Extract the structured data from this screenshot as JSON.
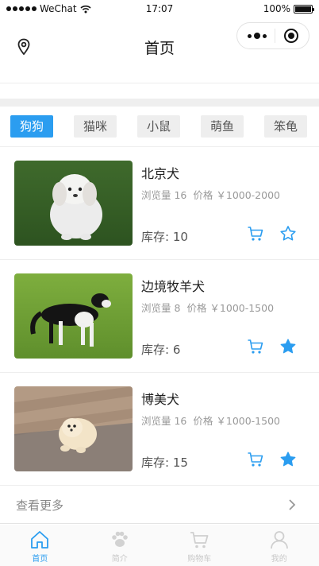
{
  "status_bar": {
    "carrier": "WeChat",
    "time": "17:07",
    "battery": "100%",
    "battery_level": 1.0
  },
  "nav": {
    "title": "首页"
  },
  "tabs": [
    {
      "label": "狗狗",
      "active": true
    },
    {
      "label": "猫咪",
      "active": false
    },
    {
      "label": "小鼠",
      "active": false
    },
    {
      "label": "萌鱼",
      "active": false
    },
    {
      "label": "笨龟",
      "active": false
    }
  ],
  "products": [
    {
      "name": "北京犬",
      "views": "浏览量 16",
      "price": "价格 ￥1000-2000",
      "stock": "库存:  10",
      "favorited": false,
      "image": "white-pekingese-on-grass"
    },
    {
      "name": "边境牧羊犬",
      "views": "浏览量 8",
      "price": "价格 ￥1000-1500",
      "stock": "库存:  6",
      "favorited": true,
      "image": "border-collie-on-grass"
    },
    {
      "name": "博美犬",
      "views": "浏览量 16",
      "price": "价格 ￥1000-1500",
      "stock": "库存:  15",
      "favorited": true,
      "image": "pomeranian-on-pavement"
    }
  ],
  "more": {
    "label": "查看更多"
  },
  "tab_bar": [
    {
      "label": "首页",
      "icon": "home-icon",
      "active": true
    },
    {
      "label": "简介",
      "icon": "paw-icon",
      "active": false
    },
    {
      "label": "购物车",
      "icon": "cart-icon",
      "active": false
    },
    {
      "label": "我的",
      "icon": "user-icon",
      "active": false
    }
  ],
  "colors": {
    "accent": "#2b9df0",
    "inactive": "#c8c8c8",
    "tab_bg": "#eeeeee"
  }
}
